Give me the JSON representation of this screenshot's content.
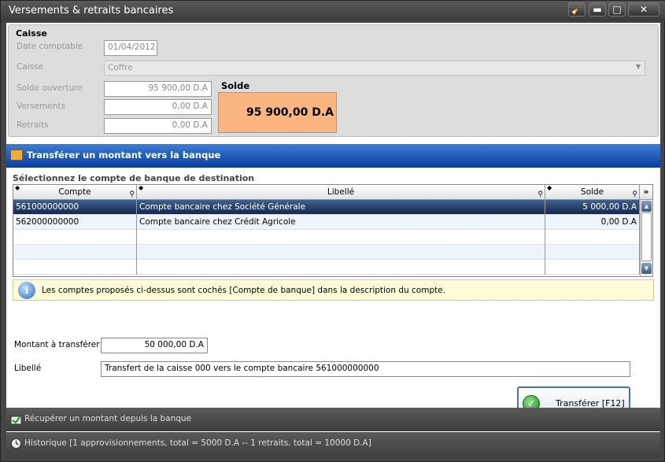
{
  "window": {
    "title": "Versements & retraits bancaires",
    "buttons": [
      "🧹",
      "▬",
      "□",
      "✕"
    ]
  },
  "caisse": {
    "group_title": "Caisse",
    "date_label": "Date comptable",
    "date_value": "01/04/2012",
    "caisse_label": "Caisse",
    "caisse_value": "Coffre",
    "solde_ouverture_label": "Solde ouverture",
    "solde_ouverture_value": "95 900,00 D.A",
    "versements_label": "Versements",
    "versements_value": "0,00 D.A",
    "retraits_label": "Retraits",
    "retraits_value": "0,00 D.A",
    "solde_label": "Solde",
    "solde_value": "95 900,00 D.A",
    "solde_color": "#fbb680"
  },
  "transfer_section": {
    "title": "Transférer un montant vers la banque",
    "select_title": "Sélectionnez le compte de banque de destination",
    "columns": [
      "Compte",
      "Libellé",
      "Solde"
    ],
    "rows": [
      {
        "compte": "561000000000",
        "libelle": "Compte bancaire chez Société Générale",
        "solde": "5 000,00 D.A"
      },
      {
        "compte": "562000000000",
        "libelle": "Compte bancaire chez Crédit Agricole",
        "solde": "0,00 D.A"
      }
    ],
    "info_text": "Les comptes proposés ci-dessus sont cochés [Compte de banque] dans la description du compte.",
    "montant_label": "Montant à transférer",
    "montant_value": "50 000,00 D.A",
    "libelle_label": "Libellé",
    "libelle_value": "Transfert de la caisse 000 vers le compte bancaire 561000000000",
    "transfer_button": "Transférer [F12]"
  },
  "recuperer_section": {
    "title": "Récupérer un montant depuis la banque"
  },
  "historique_section": {
    "title": "Historique [1 approvisionnements, total = 5000 D.A -- 1 retraits, total = 10000 D.A]"
  },
  "colors": {
    "accent_blue": "#0a3e9e",
    "selected_row": "#14284d"
  }
}
